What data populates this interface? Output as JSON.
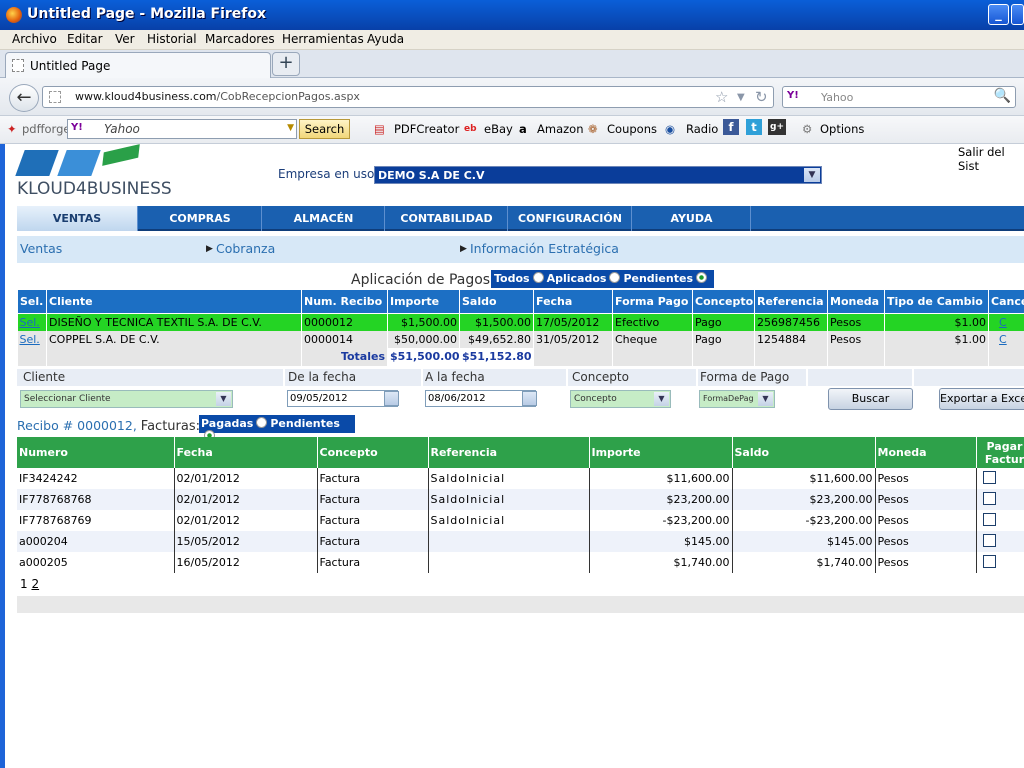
{
  "window": {
    "title": "Untitled Page - Mozilla Firefox"
  },
  "menu": [
    "Archivo",
    "Editar",
    "Ver",
    "Historial",
    "Marcadores",
    "Herramientas",
    "Ayuda"
  ],
  "tab": {
    "label": "Untitled Page"
  },
  "url": {
    "domain": "www.kloud4business.com",
    "path": "/CobRecepcionPagos.aspx"
  },
  "search": {
    "placeholder": "Yahoo",
    "engine_badge": "Y!"
  },
  "pdfbar": {
    "brand": "pdfforge",
    "search_placeholder": "Yahoo",
    "search_button": "Search",
    "items": [
      "PDFCreator",
      "eBay",
      "Amazon",
      "Coupons",
      "Radio",
      "Options"
    ]
  },
  "header": {
    "logo_text": "KLOUD4BUSINESS",
    "salir": "Salir del Sist",
    "empresa_label": "Empresa en uso:",
    "empresa_value": "DEMO S.A DE C.V"
  },
  "nav": [
    "VENTAS",
    "COMPRAS",
    "ALMACÉN",
    "CONTABILIDAD",
    "CONFIGURACIÓN",
    "AYUDA"
  ],
  "subnav": [
    "Ventas",
    "Cobranza",
    "Información Estratégica"
  ],
  "aplicacion": {
    "title": "Aplicación de Pagos",
    "filters": [
      "Todos",
      "Aplicados",
      "Pendientes"
    ],
    "selected_filter": "Pendientes"
  },
  "payments": {
    "headers": [
      "Sel.",
      "Cliente",
      "Num. Recibo",
      "Importe",
      "Saldo",
      "Fecha",
      "Forma Pago",
      "Concepto",
      "Referencia",
      "Moneda",
      "Tipo de Cambio",
      "Cancel"
    ],
    "rows": [
      {
        "sel": "Sel.",
        "cliente": "DISEÑO Y TECNICA TEXTIL S.A. DE C.V.",
        "recibo": "0000012",
        "importe": "$1,500.00",
        "saldo": "$1,500.00",
        "fecha": "17/05/2012",
        "forma": "Efectivo",
        "concepto": "Pago",
        "referencia": "256987456",
        "moneda": "Pesos",
        "tipo": "$1.00",
        "cancel": "C"
      },
      {
        "sel": "Sel.",
        "cliente": "COPPEL S.A. DE C.V.",
        "recibo": "0000014",
        "importe": "$50,000.00",
        "saldo": "$49,652.80",
        "fecha": "31/05/2012",
        "forma": "Cheque",
        "concepto": "Pago",
        "referencia": "1254884",
        "moneda": "Pesos",
        "tipo": "$1.00",
        "cancel": "C"
      }
    ],
    "totals_label": "Totales",
    "total_importe": "$51,500.00",
    "total_saldo": "$51,152.80"
  },
  "filters": {
    "cliente_label": "Cliente",
    "desde_label": "De la fecha",
    "hasta_label": "A la fecha",
    "concepto_label": "Concepto",
    "forma_label": "Forma de Pago",
    "cliente_value": "Seleccionar Cliente",
    "desde_value": "09/05/2012",
    "hasta_value": "08/06/2012",
    "concepto_value": "Concepto",
    "forma_value": "FormaDePag",
    "buscar": "Buscar",
    "exportar": "Exportar a Exce"
  },
  "recibo": {
    "link": "Recibo # 0000012,",
    "facturas_label": "Facturas:",
    "filters": [
      "Pagadas",
      "Pendientes"
    ],
    "selected_filter": "Pendientes"
  },
  "invoices": {
    "headers": [
      "Numero",
      "Fecha",
      "Concepto",
      "Referencia",
      "Importe",
      "Saldo",
      "Moneda",
      "Pagar Factur"
    ],
    "rows": [
      {
        "numero": "IF3424242",
        "fecha": "02/01/2012",
        "concepto": "Factura",
        "referencia": "SaldoInicial",
        "importe": "$11,600.00",
        "saldo": "$11,600.00",
        "moneda": "Pesos"
      },
      {
        "numero": "IF778768768",
        "fecha": "02/01/2012",
        "concepto": "Factura",
        "referencia": "SaldoInicial",
        "importe": "$23,200.00",
        "saldo": "$23,200.00",
        "moneda": "Pesos"
      },
      {
        "numero": "IF778768769",
        "fecha": "02/01/2012",
        "concepto": "Factura",
        "referencia": "SaldoInicial",
        "importe": "-$23,200.00",
        "saldo": "-$23,200.00",
        "moneda": "Pesos"
      },
      {
        "numero": "a000204",
        "fecha": "15/05/2012",
        "concepto": "Factura",
        "referencia": "",
        "importe": "$145.00",
        "saldo": "$145.00",
        "moneda": "Pesos"
      },
      {
        "numero": "a000205",
        "fecha": "16/05/2012",
        "concepto": "Factura",
        "referencia": "",
        "importe": "$1,740.00",
        "saldo": "$1,740.00",
        "moneda": "Pesos"
      }
    ]
  },
  "pager": {
    "current": "1",
    "next": "2"
  },
  "colors": {
    "brand_blue": "#1a60b0",
    "selected_row": "#24d424",
    "invoice_header": "#2ea14a"
  }
}
